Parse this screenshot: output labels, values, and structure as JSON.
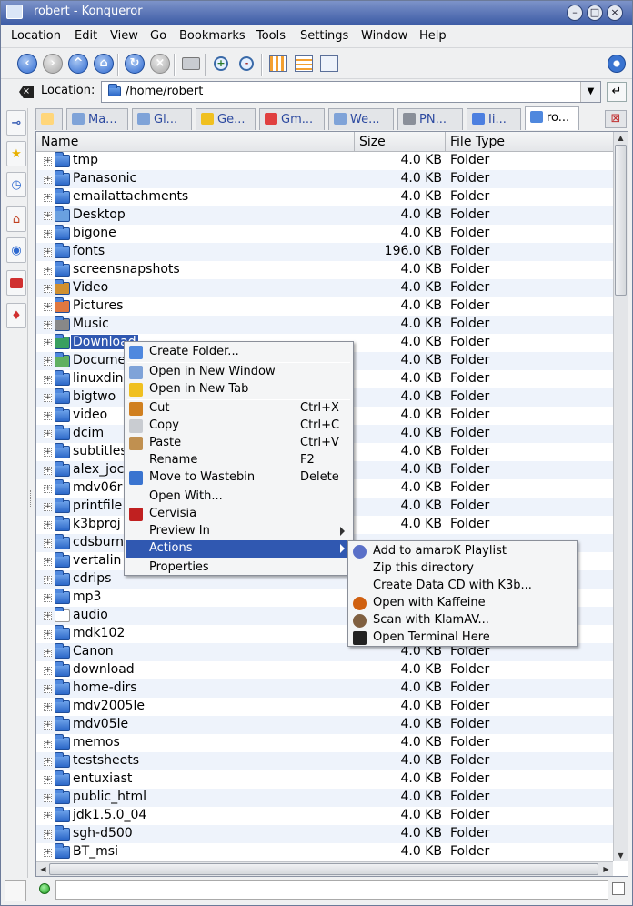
{
  "window": {
    "title": "robert - Konqueror"
  },
  "menubar": [
    "Location",
    "Edit",
    "View",
    "Go",
    "Bookmarks",
    "Tools",
    "Settings",
    "Window",
    "Help"
  ],
  "location": {
    "label": "Location:",
    "value": "/home/robert"
  },
  "tabs": [
    "Ma...",
    "Gl...",
    "Ge...",
    "Gm...",
    "We...",
    "PN...",
    "Ii...",
    "ro..."
  ],
  "columns": {
    "name": "Name",
    "size": "Size",
    "type": "File Type"
  },
  "files": [
    {
      "name": "tmp",
      "size": "4.0 KB",
      "type": "Folder"
    },
    {
      "name": "Panasonic",
      "size": "4.0 KB",
      "type": "Folder"
    },
    {
      "name": "emailattachments",
      "size": "4.0 KB",
      "type": "Folder"
    },
    {
      "name": "Desktop",
      "size": "4.0 KB",
      "type": "Folder"
    },
    {
      "name": "bigone",
      "size": "4.0 KB",
      "type": "Folder"
    },
    {
      "name": "fonts",
      "size": "196.0 KB",
      "type": "Folder"
    },
    {
      "name": "screensnapshots",
      "size": "4.0 KB",
      "type": "Folder"
    },
    {
      "name": "Video",
      "size": "4.0 KB",
      "type": "Folder"
    },
    {
      "name": "Pictures",
      "size": "4.0 KB",
      "type": "Folder"
    },
    {
      "name": "Music",
      "size": "4.0 KB",
      "type": "Folder"
    },
    {
      "name": "Download",
      "size": "4.0 KB",
      "type": "Folder"
    },
    {
      "name": "Docume",
      "size": "4.0 KB",
      "type": "Folder"
    },
    {
      "name": "linuxdin",
      "size": "4.0 KB",
      "type": "Folder"
    },
    {
      "name": "bigtwo",
      "size": "4.0 KB",
      "type": "Folder"
    },
    {
      "name": "video",
      "size": "4.0 KB",
      "type": "Folder"
    },
    {
      "name": "dcim",
      "size": "4.0 KB",
      "type": "Folder"
    },
    {
      "name": "subtitles",
      "size": "4.0 KB",
      "type": "Folder"
    },
    {
      "name": "alex_joc",
      "size": "4.0 KB",
      "type": "Folder"
    },
    {
      "name": "mdv06r",
      "size": "4.0 KB",
      "type": "Folder"
    },
    {
      "name": "printfile",
      "size": "4.0 KB",
      "type": "Folder"
    },
    {
      "name": "k3bproj",
      "size": "4.0 KB",
      "type": "Folder"
    },
    {
      "name": "cdsburn",
      "size": "",
      "type": ""
    },
    {
      "name": "vertalin",
      "size": "",
      "type": ""
    },
    {
      "name": "cdrips",
      "size": "",
      "type": ""
    },
    {
      "name": "mp3",
      "size": "",
      "type": ""
    },
    {
      "name": "audio",
      "size": "",
      "type": ""
    },
    {
      "name": "mdk102",
      "size": "",
      "type": ""
    },
    {
      "name": "Canon",
      "size": "4.0 KB",
      "type": "Folder"
    },
    {
      "name": "download",
      "size": "4.0 KB",
      "type": "Folder"
    },
    {
      "name": "home-dirs",
      "size": "4.0 KB",
      "type": "Folder"
    },
    {
      "name": "mdv2005le",
      "size": "4.0 KB",
      "type": "Folder"
    },
    {
      "name": "mdv05le",
      "size": "4.0 KB",
      "type": "Folder"
    },
    {
      "name": "memos",
      "size": "4.0 KB",
      "type": "Folder"
    },
    {
      "name": "testsheets",
      "size": "4.0 KB",
      "type": "Folder"
    },
    {
      "name": "entuxiast",
      "size": "4.0 KB",
      "type": "Folder"
    },
    {
      "name": "public_html",
      "size": "4.0 KB",
      "type": "Folder"
    },
    {
      "name": "jdk1.5.0_04",
      "size": "4.0 KB",
      "type": "Folder"
    },
    {
      "name": "sgh-d500",
      "size": "4.0 KB",
      "type": "Folder"
    },
    {
      "name": "BT_msi",
      "size": "4.0 KB",
      "type": "Folder"
    }
  ],
  "context_menu": [
    {
      "label": "Create Folder...",
      "shortcut": "",
      "icon": "new-folder-icon"
    },
    {
      "label": "Open in New Window",
      "shortcut": "",
      "icon": "window-icon"
    },
    {
      "label": "Open in New Tab",
      "shortcut": "",
      "icon": "tab-icon"
    },
    {
      "label": "Cut",
      "shortcut": "Ctrl+X",
      "icon": "scissors-icon"
    },
    {
      "label": "Copy",
      "shortcut": "Ctrl+C",
      "icon": "copy-icon"
    },
    {
      "label": "Paste",
      "shortcut": "Ctrl+V",
      "icon": "paste-icon"
    },
    {
      "label": "Rename",
      "shortcut": "F2",
      "icon": ""
    },
    {
      "label": "Move to Wastebin",
      "shortcut": "Delete",
      "icon": "trash-icon"
    },
    {
      "label": "Open With...",
      "shortcut": "",
      "icon": ""
    },
    {
      "label": "Cervisia",
      "shortcut": "",
      "icon": "cervisia-icon"
    },
    {
      "label": "Preview In",
      "shortcut": "",
      "icon": ""
    },
    {
      "label": "Actions",
      "shortcut": "",
      "icon": ""
    },
    {
      "label": "Properties",
      "shortcut": "",
      "icon": ""
    }
  ],
  "actions_submenu": [
    {
      "label": "Add to amaroK Playlist",
      "icon": "amarok-icon"
    },
    {
      "label": "Zip this directory",
      "icon": ""
    },
    {
      "label": "Create Data CD with K3b...",
      "icon": ""
    },
    {
      "label": "Open with Kaffeine",
      "icon": "kaffeine-icon"
    },
    {
      "label": "Scan with KlamAV...",
      "icon": "klamav-icon"
    },
    {
      "label": "Open Terminal Here",
      "icon": "terminal-icon"
    }
  ]
}
